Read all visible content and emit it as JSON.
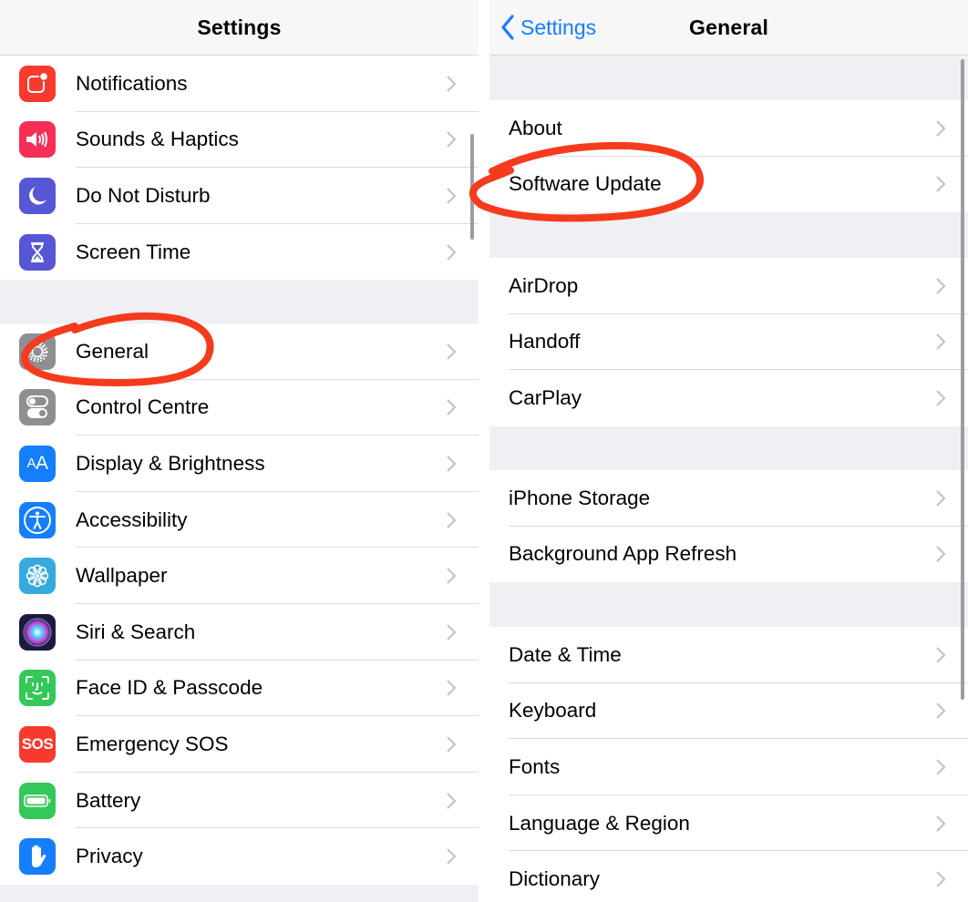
{
  "left_panel": {
    "title": "Settings",
    "groups": [
      {
        "items": [
          {
            "label": "Notifications",
            "icon": "notifications-icon",
            "icon_color": "#f7392e"
          },
          {
            "label": "Sounds & Haptics",
            "icon": "speaker-icon",
            "icon_color": "#f52f56"
          },
          {
            "label": "Do Not Disturb",
            "icon": "moon-icon",
            "icon_color": "#5756d6"
          },
          {
            "label": "Screen Time",
            "icon": "hourglass-icon",
            "icon_color": "#5756d6"
          }
        ]
      },
      {
        "items": [
          {
            "label": "General",
            "icon": "gear-icon",
            "icon_color": "#8e8e93",
            "annotated": true
          },
          {
            "label": "Control Centre",
            "icon": "toggles-icon",
            "icon_color": "#8e8e93"
          },
          {
            "label": "Display & Brightness",
            "icon": "text-size-icon",
            "icon_color": "#157efb",
            "icon_text": "AA"
          },
          {
            "label": "Accessibility",
            "icon": "accessibility-icon",
            "icon_color": "#157efb"
          },
          {
            "label": "Wallpaper",
            "icon": "flower-icon",
            "icon_color": "#36aadc"
          },
          {
            "label": "Siri & Search",
            "icon": "siri-icon",
            "icon_color": "#1c1a40"
          },
          {
            "label": "Face ID & Passcode",
            "icon": "face-id-icon",
            "icon_color": "#34c759"
          },
          {
            "label": "Emergency SOS",
            "icon": "sos-icon",
            "icon_color": "#f7392e",
            "icon_text": "SOS"
          },
          {
            "label": "Battery",
            "icon": "battery-icon",
            "icon_color": "#34c759"
          },
          {
            "label": "Privacy",
            "icon": "hand-icon",
            "icon_color": "#157efb"
          }
        ]
      }
    ]
  },
  "right_panel": {
    "back_label": "Settings",
    "title": "General",
    "groups": [
      {
        "items": [
          {
            "label": "About"
          },
          {
            "label": "Software Update",
            "annotated": true
          }
        ]
      },
      {
        "items": [
          {
            "label": "AirDrop"
          },
          {
            "label": "Handoff"
          },
          {
            "label": "CarPlay"
          }
        ]
      },
      {
        "items": [
          {
            "label": "iPhone Storage"
          },
          {
            "label": "Background App Refresh"
          }
        ]
      },
      {
        "items": [
          {
            "label": "Date & Time"
          },
          {
            "label": "Keyboard"
          },
          {
            "label": "Fonts"
          },
          {
            "label": "Language & Region"
          },
          {
            "label": "Dictionary"
          }
        ]
      }
    ]
  },
  "colors": {
    "accent": "#157efb",
    "annotation": "#f53b1d",
    "grouped_background": "#efeff4",
    "chevron": "#c4c4c7"
  }
}
